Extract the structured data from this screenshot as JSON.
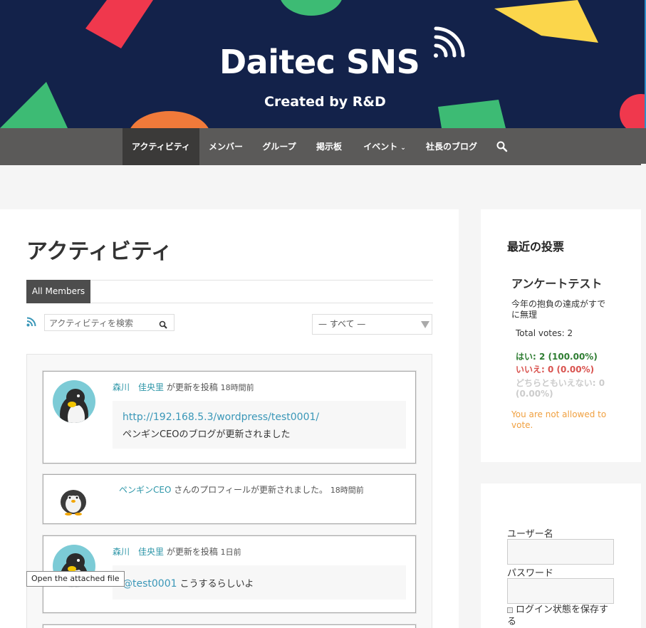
{
  "header": {
    "title": "Daitec SNS",
    "subtitle": "Created by R&D",
    "colors": {
      "background": "#13224a",
      "red": "#f0384d",
      "green": "#3dbb74",
      "yellow": "#fbd64b",
      "orange": "#f07a3a"
    }
  },
  "nav": {
    "items": [
      {
        "label": "アクティビティ",
        "active": true
      },
      {
        "label": "メンバー"
      },
      {
        "label": "グループ"
      },
      {
        "label": "掲示板"
      },
      {
        "label": "イベント",
        "has_dropdown": true
      },
      {
        "label": "社長のブログ"
      }
    ],
    "search_icon": "search-icon"
  },
  "main": {
    "title": "アクティビティ",
    "tab_all": "All Members",
    "search_placeholder": "アクティビティを検索",
    "filter_value": "— すべて —",
    "activities": [
      {
        "user": "森川　佳央里",
        "action": " が更新を投稿 ",
        "time": "18時間前",
        "link": "http://192.168.5.3/wordpress/test0001/",
        "text": "ペンギンCEOのブログが更新されました"
      },
      {
        "user": "ペンギンCEO",
        "action": " さんのプロフィールが更新されました。 ",
        "time": "18時間前"
      },
      {
        "user": "森川　佳央里",
        "action": " が更新を投稿 ",
        "time": "1日前",
        "mention": "@test0001",
        "text": " こうするらしいよ"
      }
    ],
    "tooltip": "Open the attached file"
  },
  "sidebar": {
    "title": "最近の投票",
    "poll": {
      "title": "アンケートテスト",
      "question": "今年の抱負の達成がすでに無理",
      "total": "Total votes: 2",
      "options": [
        {
          "label": "はい: 2 (100.00%)",
          "color": "#2e7d32"
        },
        {
          "label": "いいえ: 0 (0.00%)",
          "color": "#d9534f"
        },
        {
          "label": "どちらともいえない: 0 (0.00%)",
          "color": "#cccccc"
        }
      ],
      "note": "You are not allowed to vote."
    },
    "login": {
      "username_label": "ユーザー名",
      "password_label": "パスワード",
      "remember_label": "ログイン状態を保存する"
    }
  }
}
